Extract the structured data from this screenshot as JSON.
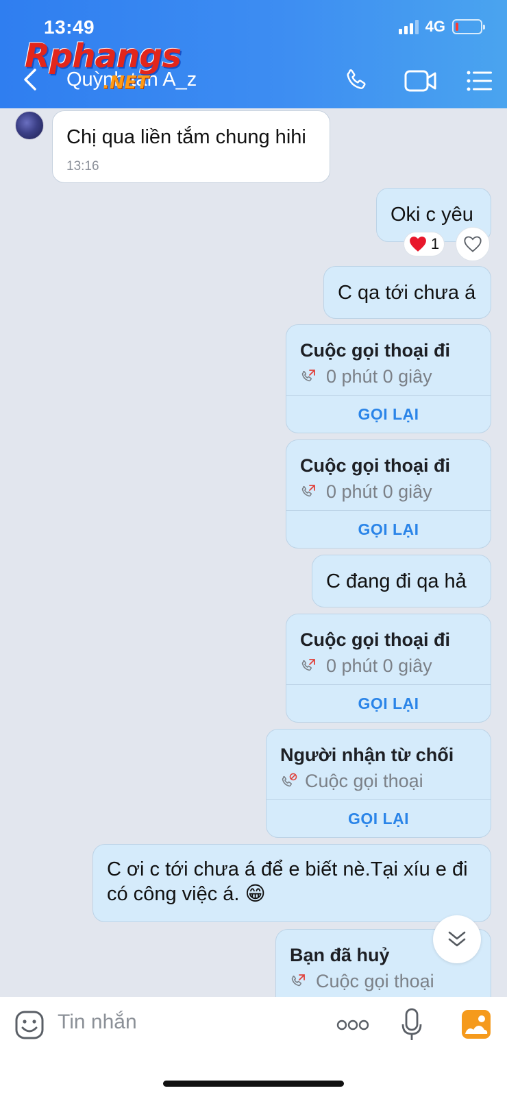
{
  "status_bar": {
    "time": "13:49",
    "network": "4G"
  },
  "header": {
    "contact_name": "Quỳnh tan A_z"
  },
  "watermark": {
    "main": "Rphangs",
    "sub": ".NET"
  },
  "messages": {
    "m1": {
      "text": "Chị qua liền tắm chung hihi",
      "time": "13:16"
    },
    "m2": {
      "text": "Oki c yêu",
      "reaction_count": "1"
    },
    "m3": {
      "text": "C qa tới chưa á"
    },
    "m4": {
      "title": "Cuộc gọi thoại đi",
      "detail": "0 phút 0 giây",
      "action": "GỌI LẠI"
    },
    "m5": {
      "title": "Cuộc gọi thoại đi",
      "detail": "0 phút 0 giây",
      "action": "GỌI LẠI"
    },
    "m6": {
      "text": "C đang đi qa hả"
    },
    "m7": {
      "title": "Cuộc gọi thoại đi",
      "detail": "0 phút 0 giây",
      "action": "GỌI LẠI"
    },
    "m8": {
      "title": "Người nhận từ chối",
      "detail": "Cuộc gọi thoại",
      "action": "GỌI LẠI"
    },
    "m9": {
      "text": "C ơi c tới chưa á để e biết nè.Tại xíu e đi có công việc á. 😁"
    },
    "m10": {
      "title": "Bạn đã huỷ",
      "detail": "Cuộc gọi thoại"
    }
  },
  "input": {
    "placeholder": "Tin nhắn"
  },
  "colors": {
    "header_start": "#2f7ef0",
    "header_end": "#4aa4ef",
    "outgoing_bubble": "#d5ebfb",
    "accent": "#2a84e8",
    "chat_bg": "#e2e6ee"
  },
  "icons": [
    "back-icon",
    "phone-icon",
    "video-camera-icon",
    "menu-list-icon",
    "heart-icon",
    "outgoing-call-icon",
    "declined-call-icon",
    "chevron-double-down-icon",
    "sticker-icon",
    "more-options-icon",
    "microphone-icon",
    "image-gallery-icon"
  ]
}
